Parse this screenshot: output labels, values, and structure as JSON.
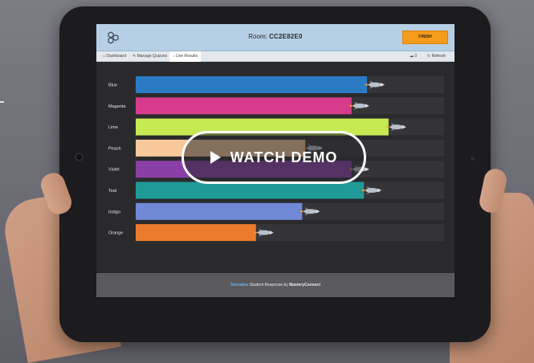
{
  "app": {
    "room_label": "Room:",
    "room_code": "CC2E82E0",
    "finish_label": "FINISH",
    "logo_icon": "hexagon-logo-icon"
  },
  "nav": {
    "tabs": [
      {
        "label": "Dashboard",
        "icon": "home-icon"
      },
      {
        "label": "Manage Quizzes",
        "icon": "wrench-icon"
      },
      {
        "label": "Live Results",
        "icon": "pin-icon",
        "active": true
      }
    ],
    "right": [
      {
        "label": "0",
        "icon": "cloud-icon"
      },
      {
        "label": "Refresh",
        "icon": "refresh-icon"
      }
    ]
  },
  "chart_data": {
    "type": "bar",
    "orientation": "horizontal",
    "categories": [
      "Blue",
      "Magenta",
      "Lime",
      "Peach",
      "Violet",
      "Teal",
      "Indigo",
      "Orange"
    ],
    "values": [
      0.75,
      0.7,
      0.82,
      0.55,
      0.7,
      0.74,
      0.54,
      0.39
    ],
    "value_unit": "fraction of track",
    "colors": [
      "#2b7bc4",
      "#d63c8b",
      "#c6ea52",
      "#f7c89a",
      "#8a3fa6",
      "#1f9a96",
      "#6f89d6",
      "#ec7b2e"
    ],
    "marker_icon": "rocket-icon",
    "title": "",
    "xlabel": "",
    "ylabel": ""
  },
  "footer": {
    "brand": "Socrative",
    "middle": " Student Response by ",
    "company": "MasteryConnect"
  },
  "overlay": {
    "label": "WATCH DEMO",
    "icon": "play-icon"
  }
}
